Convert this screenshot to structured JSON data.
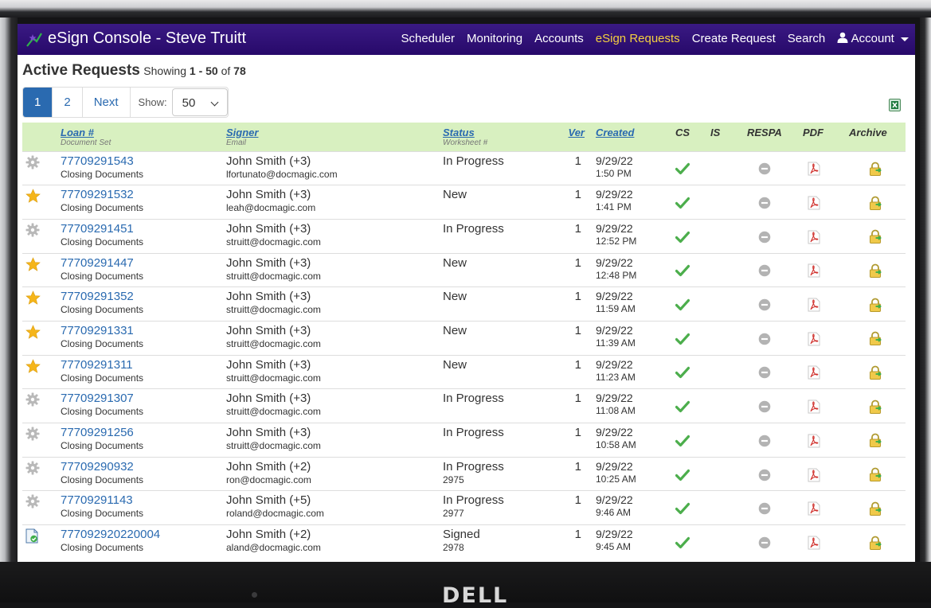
{
  "app": {
    "title": "eSign Console - Steve Truitt",
    "brand_color": "#2d0f74",
    "active_color": "#f4d03f"
  },
  "nav": {
    "items": [
      {
        "label": "Scheduler",
        "active": false
      },
      {
        "label": "Monitoring",
        "active": false
      },
      {
        "label": "Accounts",
        "active": false
      },
      {
        "label": "eSign Requests",
        "active": true
      },
      {
        "label": "Create Request",
        "active": false
      },
      {
        "label": "Search",
        "active": false
      }
    ],
    "account_label": "Account"
  },
  "page": {
    "heading": "Active Requests",
    "showing_prefix": "Showing",
    "range": "1 - 50",
    "of_label": "of",
    "total": "78"
  },
  "pager": {
    "pages": [
      "1",
      "2"
    ],
    "next_label": "Next",
    "show_label": "Show:",
    "page_size": "50"
  },
  "table": {
    "headers": {
      "loan": "Loan #",
      "loan_sub": "Document Set",
      "signer": "Signer",
      "signer_sub": "Email",
      "status": "Status",
      "status_sub": "Worksheet #",
      "ver": "Ver",
      "created": "Created",
      "cs": "CS",
      "is": "IS",
      "respa": "RESPA",
      "pdf": "PDF",
      "archive": "Archive"
    },
    "rows": [
      {
        "type_icon": "gear-icon",
        "loan": "77709291543",
        "docset": "Closing Documents",
        "signer": "John Smith (+3)",
        "email": "lfortunato@docmagic.com",
        "status": "In Progress",
        "worksheet": "",
        "ver": "1",
        "date": "9/29/22",
        "time": "1:50 PM"
      },
      {
        "type_icon": "star-icon",
        "loan": "77709291532",
        "docset": "Closing Documents",
        "signer": "John Smith (+3)",
        "email": "leah@docmagic.com",
        "status": "New",
        "worksheet": "",
        "ver": "1",
        "date": "9/29/22",
        "time": "1:41 PM"
      },
      {
        "type_icon": "gear-icon",
        "loan": "77709291451",
        "docset": "Closing Documents",
        "signer": "John Smith (+3)",
        "email": "struitt@docmagic.com",
        "status": "In Progress",
        "worksheet": "",
        "ver": "1",
        "date": "9/29/22",
        "time": "12:52 PM"
      },
      {
        "type_icon": "star-icon",
        "loan": "77709291447",
        "docset": "Closing Documents",
        "signer": "John Smith (+3)",
        "email": "struitt@docmagic.com",
        "status": "New",
        "worksheet": "",
        "ver": "1",
        "date": "9/29/22",
        "time": "12:48 PM"
      },
      {
        "type_icon": "star-icon",
        "loan": "77709291352",
        "docset": "Closing Documents",
        "signer": "John Smith (+3)",
        "email": "struitt@docmagic.com",
        "status": "New",
        "worksheet": "",
        "ver": "1",
        "date": "9/29/22",
        "time": "11:59 AM"
      },
      {
        "type_icon": "star-icon",
        "loan": "77709291331",
        "docset": "Closing Documents",
        "signer": "John Smith (+3)",
        "email": "struitt@docmagic.com",
        "status": "New",
        "worksheet": "",
        "ver": "1",
        "date": "9/29/22",
        "time": "11:39 AM"
      },
      {
        "type_icon": "star-icon",
        "loan": "77709291311",
        "docset": "Closing Documents",
        "signer": "John Smith (+3)",
        "email": "struitt@docmagic.com",
        "status": "New",
        "worksheet": "",
        "ver": "1",
        "date": "9/29/22",
        "time": "11:23 AM"
      },
      {
        "type_icon": "gear-icon",
        "loan": "77709291307",
        "docset": "Closing Documents",
        "signer": "John Smith (+3)",
        "email": "struitt@docmagic.com",
        "status": "In Progress",
        "worksheet": "",
        "ver": "1",
        "date": "9/29/22",
        "time": "11:08 AM"
      },
      {
        "type_icon": "gear-icon",
        "loan": "77709291256",
        "docset": "Closing Documents",
        "signer": "John Smith (+3)",
        "email": "struitt@docmagic.com",
        "status": "In Progress",
        "worksheet": "",
        "ver": "1",
        "date": "9/29/22",
        "time": "10:58 AM"
      },
      {
        "type_icon": "gear-icon",
        "loan": "77709290932",
        "docset": "Closing Documents",
        "signer": "John Smith (+2)",
        "email": "ron@docmagic.com",
        "status": "In Progress",
        "worksheet": "2975",
        "ver": "1",
        "date": "9/29/22",
        "time": "10:25 AM"
      },
      {
        "type_icon": "gear-icon",
        "loan": "77709291143",
        "docset": "Closing Documents",
        "signer": "John Smith (+5)",
        "email": "roland@docmagic.com",
        "status": "In Progress",
        "worksheet": "2977",
        "ver": "1",
        "date": "9/29/22",
        "time": "9:46 AM"
      },
      {
        "type_icon": "document-icon",
        "loan": "777092920220004",
        "docset": "Closing Documents",
        "signer": "John Smith (+2)",
        "email": "aland@docmagic.com",
        "status": "Signed",
        "worksheet": "2978",
        "ver": "1",
        "date": "9/29/22",
        "time": "9:45 AM"
      }
    ]
  },
  "device": {
    "brand": "DELL"
  }
}
